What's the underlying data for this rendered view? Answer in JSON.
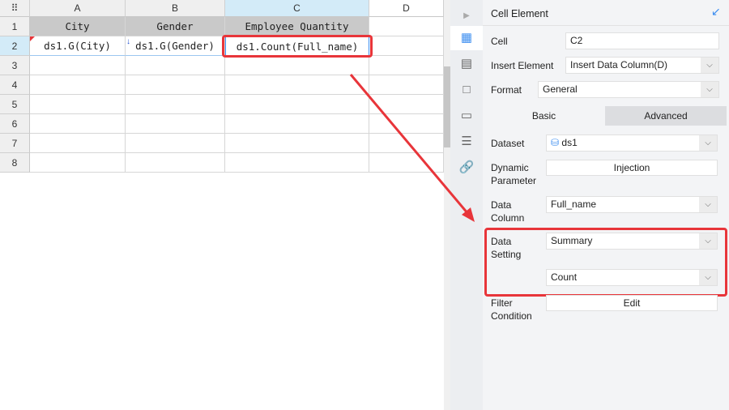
{
  "sheet": {
    "columns": [
      "A",
      "B",
      "C",
      "D"
    ],
    "rows": [
      "1",
      "2",
      "3",
      "4",
      "5",
      "6",
      "7",
      "8"
    ],
    "row1": [
      "City",
      "Gender",
      "Employee Quantity"
    ],
    "row2": [
      "ds1.G(City)",
      "ds1.G(Gender)",
      "ds1.Count(Full_name)"
    ]
  },
  "panel": {
    "title": "Cell Element",
    "cell_label": "Cell",
    "cell_value": "C2",
    "insert_label": "Insert Element",
    "insert_value": "Insert Data Column(D)",
    "format_label": "Format",
    "format_value": "General",
    "tabs": [
      "Basic",
      "Advanced"
    ],
    "dataset_label": "Dataset",
    "dataset_value": "ds1",
    "dynparam_label1": "Dynamic",
    "dynparam_label2": "Parameter",
    "dynparam_button": "Injection",
    "datacol_label1": "Data",
    "datacol_label2": "Column",
    "datacol_value": "Full_name",
    "datasetting_label1": "Data",
    "datasetting_label2": "Setting",
    "datasetting_value": "Summary",
    "summary_value": "Count",
    "filter_label1": "Filter",
    "filter_label2": "Condition",
    "filter_button": "Edit"
  },
  "colors": {
    "highlight": "#e8353a",
    "accent": "#3d8ef0"
  }
}
